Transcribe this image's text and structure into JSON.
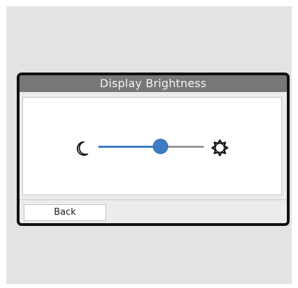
{
  "screen": {
    "title": "Display Brightness"
  },
  "brightness": {
    "level_fraction": 0.59,
    "low_icon": "moon-icon",
    "high_icon": "sun-icon"
  },
  "footer": {
    "back_label": "Back"
  },
  "colors": {
    "accent": "#3d7cc4",
    "title_bar": "#777776",
    "track_inactive": "#9a9a9a",
    "frame": "#111111"
  }
}
